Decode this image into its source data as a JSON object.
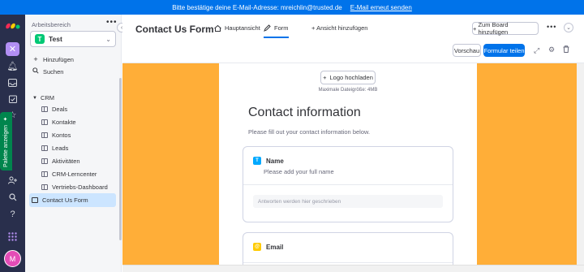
{
  "banner": {
    "message": "Bitte bestätige deine E-Mail-Adresse: mreichlin@trusted.de",
    "link": "E-Mail erneut senden"
  },
  "rail": {
    "palette_label": "Palette anzeigen",
    "avatar_initial": "M",
    "app_initial": "✕"
  },
  "sidebar": {
    "workspace_label": "Arbeitsbereich",
    "workspace_initial": "T",
    "workspace_name": "Test",
    "add_label": "Hinzufügen",
    "search_label": "Suchen",
    "folder_name": "CRM",
    "boards": [
      "Deals",
      "Kontakte",
      "Kontos",
      "Leads",
      "Aktivitäten",
      "CRM-Lerncenter",
      "Vertriebs-Dashboard"
    ],
    "active_board": "Contact Us Form"
  },
  "header": {
    "title": "Contact Us Form",
    "tab_main": "Hauptansicht",
    "tab_form": "Form",
    "add_view": "Ansicht hinzufügen",
    "add_to_board": "Zum Board hinzufügen",
    "preview": "Vorschau",
    "share_form": "Formular teilen"
  },
  "form": {
    "logo_upload": "Logo hochladen",
    "logo_hint": "Maximale Dateigröße: 4MB",
    "title": "Contact information",
    "subtitle": "Please fill out your contact information below.",
    "questions": [
      {
        "badge": "T",
        "label": "Name",
        "description": "Please add your full name",
        "answer_placeholder": "Antworten werden hier geschrieben"
      },
      {
        "badge": "@",
        "label": "Email"
      }
    ]
  },
  "colors": {
    "banner": "#0073ea",
    "rail": "#292f4c",
    "canvas": "#ffae38",
    "primary": "#0073ea",
    "palette_tab": "#00854d"
  }
}
